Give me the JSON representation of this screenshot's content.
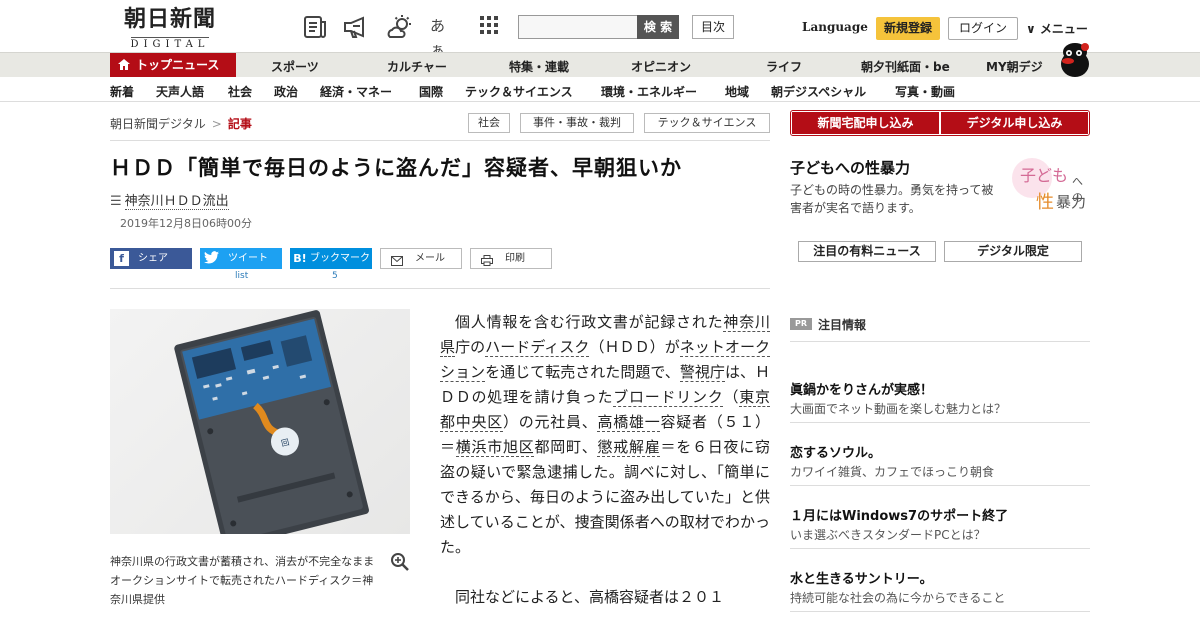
{
  "header": {
    "logo_jp": "朝日新聞",
    "logo_en": "DIGITAL",
    "search_button": "検 索",
    "toc_button": "目次",
    "language": "Language",
    "signup": "新規登録",
    "login": "ログイン",
    "menu": "∨ メニュー",
    "icons": [
      "newspaper-icon",
      "megaphone-icon",
      "weather-icon",
      "font-size-icon",
      "grid-icon"
    ],
    "font_icon_text": "あぁ"
  },
  "nav_primary": {
    "active": "トップニュース",
    "items": [
      "スポーツ",
      "カルチャー",
      "特集・連載",
      "オピニオン",
      "ライフ",
      "朝夕刊紙面・be",
      "MY朝デジ"
    ]
  },
  "nav_secondary": {
    "items": [
      "新着",
      "天声人語",
      "社会",
      "政治",
      "経済・マネー",
      "国際",
      "テック＆サイエンス",
      "環境・エネルギー",
      "地域",
      "朝デジスペシャル",
      "写真・動画"
    ]
  },
  "breadcrumb": {
    "home": "朝日新聞デジタル",
    "sep": ">",
    "current": "記事"
  },
  "tags": [
    "社会",
    "事件・事故・裁判",
    "テック＆サイエンス"
  ],
  "article": {
    "headline": "ＨＤＤ「簡単で毎日のように盗んだ」容疑者、早朝狙いか",
    "series_icon": "☰",
    "series": "神奈川ＨＤＤ流出",
    "date": "2019年12月8日06時00分",
    "caption": "神奈川県の行政文書が蓄積され、消去が不完全なままオークションサイトで転売されたハードディスク＝神奈川県提供",
    "photo_label": "hard-disk-drive-photo",
    "p1_segments": [
      {
        "t": "個人情報を含む行政文書が記録された",
        "link": false
      },
      {
        "t": "神奈川県",
        "link": true
      },
      {
        "t": "庁の",
        "link": false
      },
      {
        "t": "ハードディスク",
        "link": true
      },
      {
        "t": "（ＨＤＤ）が",
        "link": false
      },
      {
        "t": "ネットオークション",
        "link": true
      },
      {
        "t": "を通じて転売された問題で、",
        "link": false
      },
      {
        "t": "警視庁",
        "link": true
      },
      {
        "t": "は、ＨＤＤの処理を請け負った",
        "link": false
      },
      {
        "t": "ブロードリンク",
        "link": true
      },
      {
        "t": "（",
        "link": false
      },
      {
        "t": "東京都中央区",
        "link": true
      },
      {
        "t": "）の元社員、",
        "link": false
      },
      {
        "t": "高橋雄一",
        "link": true
      },
      {
        "t": "容疑者（５１）＝",
        "link": false
      },
      {
        "t": "横浜市旭区",
        "link": true
      },
      {
        "t": "都岡町、",
        "link": false
      },
      {
        "t": "懲戒解雇",
        "link": true
      },
      {
        "t": "＝を６日夜に窃盗の疑いで緊急逮捕した。調べに対し、「簡単にできるから、毎日のように盗み出していた」と供述していることが、捜査関係者への取材でわかった。",
        "link": false
      }
    ],
    "p2": "同社などによると、高橋容疑者は２０１"
  },
  "share": {
    "facebook": "シェア",
    "twitter": "ツイート",
    "twitter_count": "list",
    "hatena": "ブックマーク",
    "hatena_count": "5",
    "mail": "メール",
    "print": "印刷"
  },
  "sidebar": {
    "subscribe_paper": "新聞宅配申し込み",
    "subscribe_digital": "デジタル申し込み",
    "promo_title": "子どもへの性暴力",
    "promo_desc": "子どもの時の性暴力。勇気を持って被害者が実名で語ります。",
    "promo_art_a": "子ども",
    "promo_art_b": "への",
    "promo_art_c": "性",
    "promo_art_d": "暴力",
    "btn_paid_news": "注目の有料ニュース",
    "btn_digital_only": "デジタル限定",
    "pr_badge": "PR",
    "pr_label": "注目情報",
    "pr_items": [
      {
        "title": "眞鍋かをりさんが実感！",
        "desc": "大画面でネット動画を楽しむ魅力とは？"
      },
      {
        "title": "恋するソウル。",
        "desc": "カワイイ雑貨、カフェでほっこり朝食"
      },
      {
        "title": "１月にはWindows7のサポート終了",
        "desc": "いま選ぶべきスタンダードPCとは？"
      },
      {
        "title": "水と生きるサントリー。",
        "desc": "持続可能な社会の為に今からできること"
      }
    ]
  },
  "colors": {
    "brand_red": "#b40d16",
    "signup_yellow": "#f5c33b",
    "facebook": "#3b5998",
    "twitter": "#1da1f2",
    "hatena": "#008fde"
  }
}
